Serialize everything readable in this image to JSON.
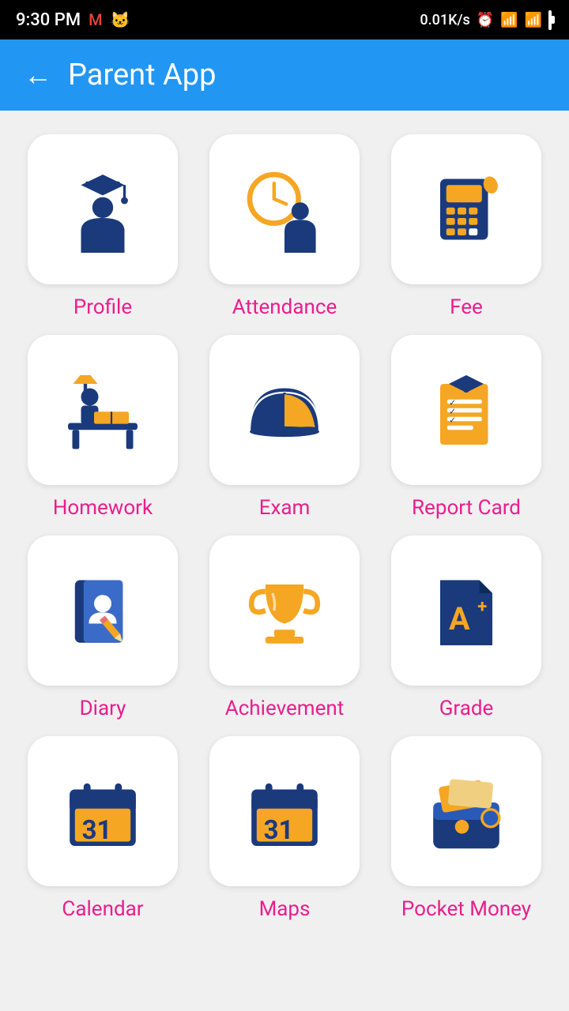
{
  "statusBar": {
    "time": "9:30 PM",
    "network": "0.01K/s",
    "battery": "100"
  },
  "header": {
    "title": "Parent App",
    "backLabel": "←"
  },
  "items": [
    {
      "id": "profile",
      "label": "Profile"
    },
    {
      "id": "attendance",
      "label": "Attendance"
    },
    {
      "id": "fee",
      "label": "Fee"
    },
    {
      "id": "homework",
      "label": "Homework"
    },
    {
      "id": "exam",
      "label": "Exam"
    },
    {
      "id": "report-card",
      "label": "Report Card"
    },
    {
      "id": "diary",
      "label": "Diary"
    },
    {
      "id": "achievement",
      "label": "Achievement"
    },
    {
      "id": "grade",
      "label": "Grade"
    },
    {
      "id": "calendar",
      "label": "Calendar"
    },
    {
      "id": "maps",
      "label": "Maps"
    },
    {
      "id": "pocket-money",
      "label": "Pocket Money"
    }
  ]
}
